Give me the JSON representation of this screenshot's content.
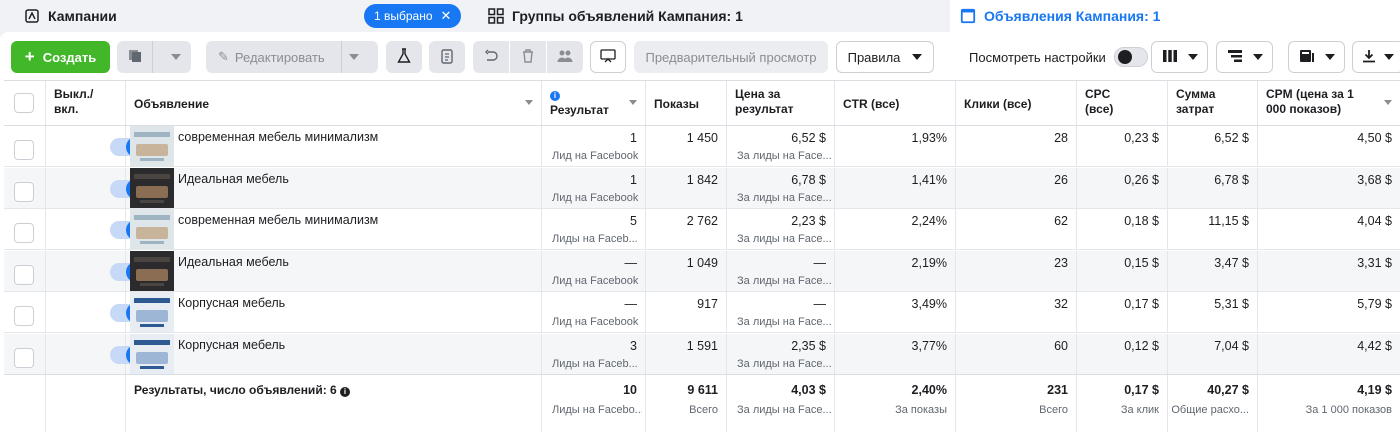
{
  "tabs": {
    "campaigns": "Кампании",
    "selected_pill": "1 выбрано",
    "adsets": "Группы объявлений Кампания: 1",
    "ads": "Объявления Кампания: 1"
  },
  "toolbar": {
    "create": "Создать",
    "edit": "Редактировать",
    "preview": "Предварительный просмотр",
    "rules": "Правила",
    "view_settings": "Посмотреть настройки"
  },
  "columns": {
    "onoff": "Выкл./ вкл.",
    "ad": "Объявление",
    "results": "Результат",
    "impressions": "Показы",
    "cost_per_result": "Цена за результат",
    "ctr": "CTR (все)",
    "clicks": "Клики (все)",
    "cpc": "CPC (все)",
    "spend": "Сумма затрат",
    "cpm": "CPM (цена за 1 000 показов)"
  },
  "rows": [
    {
      "name": "современная мебель минимализм",
      "results": "1",
      "results_sub": "Лид на Facebook",
      "impressions": "1 450",
      "cpr": "6,52 $",
      "cpr_sub": "За лиды на Face...",
      "ctr": "1,93%",
      "clicks": "28",
      "cpc": "0,23 $",
      "spend": "6,52 $",
      "cpm": "4,50 $"
    },
    {
      "name": "Идеальная мебель",
      "results": "1",
      "results_sub": "Лид на Facebook",
      "impressions": "1 842",
      "cpr": "6,78 $",
      "cpr_sub": "За лиды на Face...",
      "ctr": "1,41%",
      "clicks": "26",
      "cpc": "0,26 $",
      "spend": "6,78 $",
      "cpm": "3,68 $"
    },
    {
      "name": "современная мебель минимализм",
      "results": "5",
      "results_sub": "Лиды на Faceb...",
      "impressions": "2 762",
      "cpr": "2,23 $",
      "cpr_sub": "За лиды на Face...",
      "ctr": "2,24%",
      "clicks": "62",
      "cpc": "0,18 $",
      "spend": "11,15 $",
      "cpm": "4,04 $"
    },
    {
      "name": "Идеальная мебель",
      "results": "—",
      "results_sub": "Лид на Facebook",
      "impressions": "1 049",
      "cpr": "—",
      "cpr_sub": "За лиды на Face...",
      "ctr": "2,19%",
      "clicks": "23",
      "cpc": "0,15 $",
      "spend": "3,47 $",
      "cpm": "3,31 $"
    },
    {
      "name": "Корпусная мебель",
      "results": "—",
      "results_sub": "Лид на Facebook",
      "impressions": "917",
      "cpr": "—",
      "cpr_sub": "За лиды на Face...",
      "ctr": "3,49%",
      "clicks": "32",
      "cpc": "0,17 $",
      "spend": "5,31 $",
      "cpm": "5,79 $"
    },
    {
      "name": "Корпусная мебель",
      "results": "3",
      "results_sub": "Лиды на Faceb...",
      "impressions": "1 591",
      "cpr": "2,35 $",
      "cpr_sub": "За лиды на Face...",
      "ctr": "3,77%",
      "clicks": "60",
      "cpc": "0,12 $",
      "spend": "7,04 $",
      "cpm": "4,42 $"
    }
  ],
  "totals": {
    "label": "Результаты, число объявлений: 6",
    "results": "10",
    "results_sub": "Лиды на Facebo...",
    "impressions": "9 611",
    "impressions_sub": "Всего",
    "cpr": "4,03 $",
    "cpr_sub": "За лиды на Face...",
    "ctr": "2,40%",
    "ctr_sub": "За показы",
    "clicks": "231",
    "clicks_sub": "Всего",
    "cpc": "0,17 $",
    "cpc_sub": "За клик",
    "spend": "40,27 $",
    "spend_sub": "Общие расхо...",
    "cpm": "4,19 $",
    "cpm_sub": "За 1 000 показов"
  },
  "colors": {
    "accent": "#1877f2",
    "create_green": "#42b72a"
  }
}
